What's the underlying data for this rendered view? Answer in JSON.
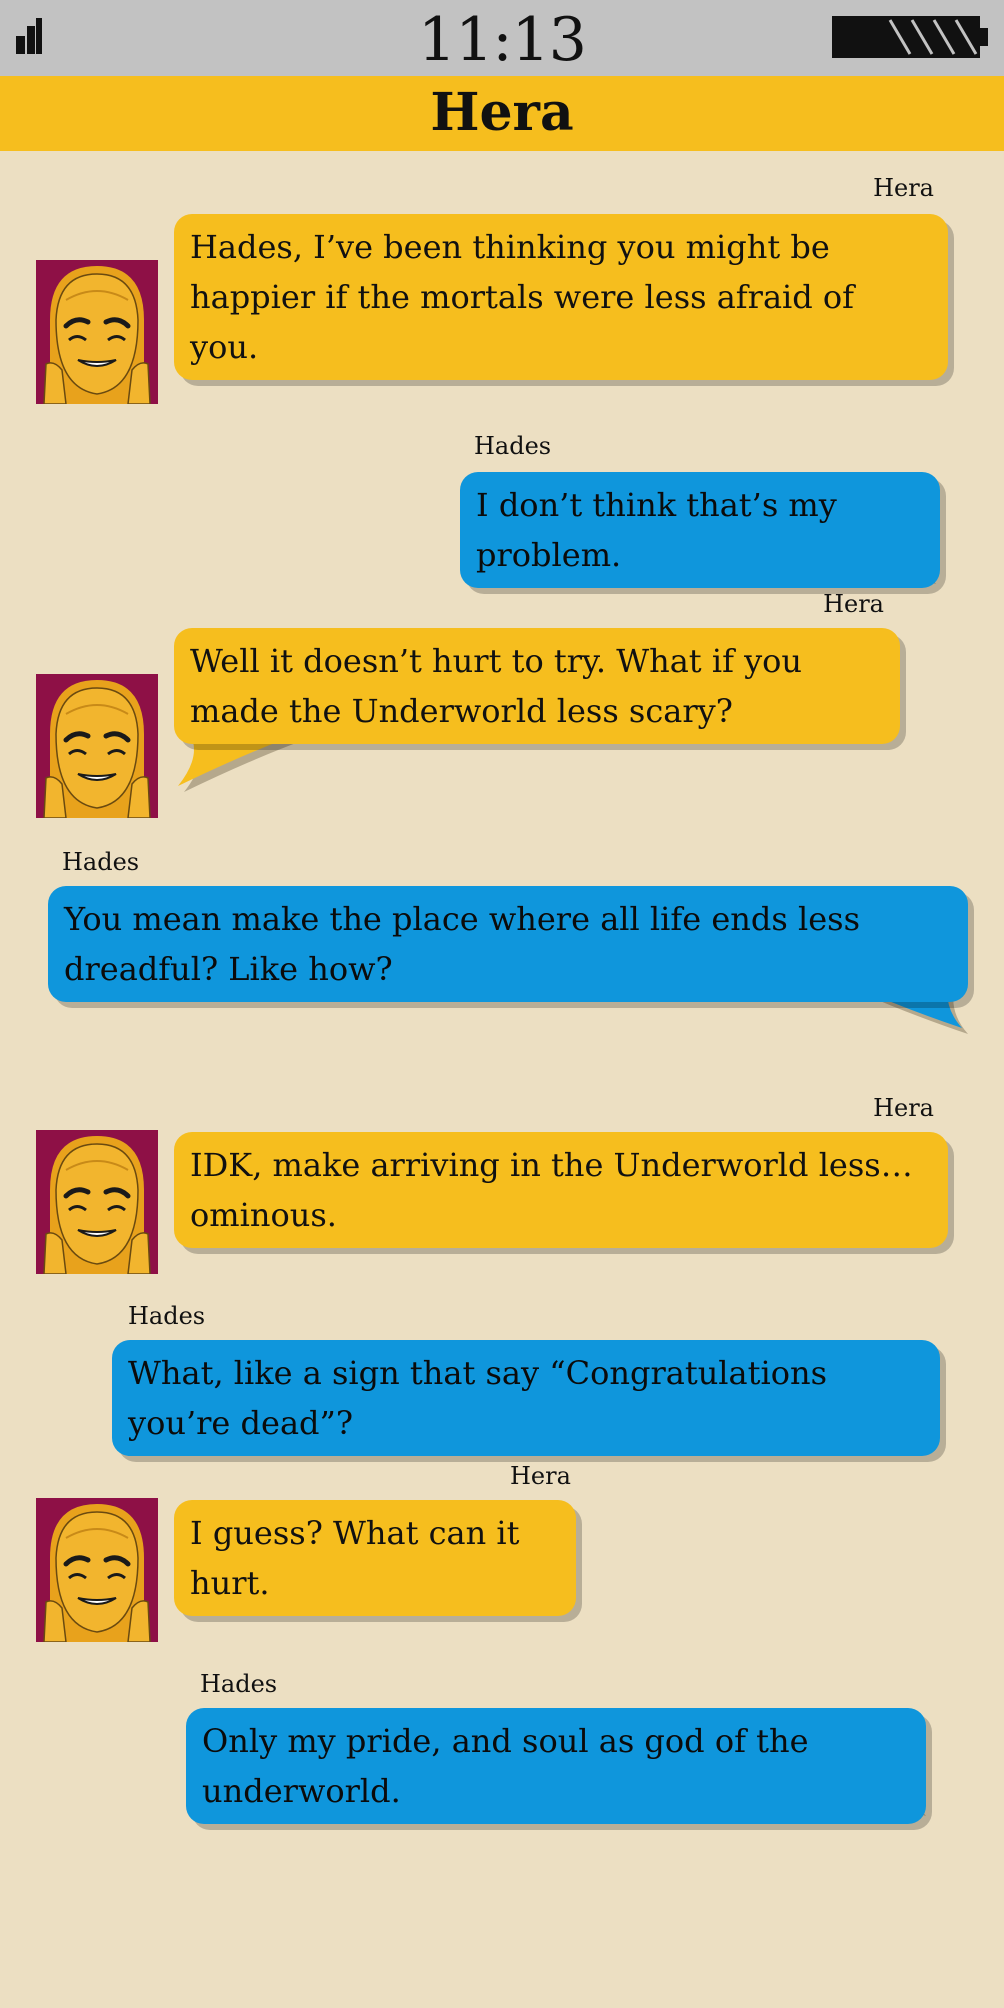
{
  "status_bar": {
    "time": "11:13"
  },
  "header": {
    "title": "Hera"
  },
  "colors": {
    "hera": "#f6be1e",
    "hades": "#0f96dc",
    "background": "#ecdfc2",
    "status_bar": "#c2c2c2"
  },
  "icons": {
    "signal": "signal-icon",
    "battery": "battery-icon"
  },
  "messages": [
    {
      "sender": "Hera",
      "text": "Hades, I’ve been thinking you might be happier if the mortals were less afraid of you."
    },
    {
      "sender": "Hades",
      "text": "I don’t think that’s my problem."
    },
    {
      "sender": "Hera",
      "text": "Well it doesn’t hurt to try. What if you made the Underworld less scary?"
    },
    {
      "sender": "Hades",
      "text": "You mean make the place where all life ends less dreadful? Like how?"
    },
    {
      "sender": "Hera",
      "text": "IDK, make arriving in the Underworld less…ominous."
    },
    {
      "sender": "Hades",
      "text": "What, like a sign that say “Congratulations you’re dead”?"
    },
    {
      "sender": "Hera",
      "text": "I guess? What can it hurt."
    },
    {
      "sender": "Hades",
      "text": "Only my pride, and soul as god of the underworld."
    }
  ]
}
